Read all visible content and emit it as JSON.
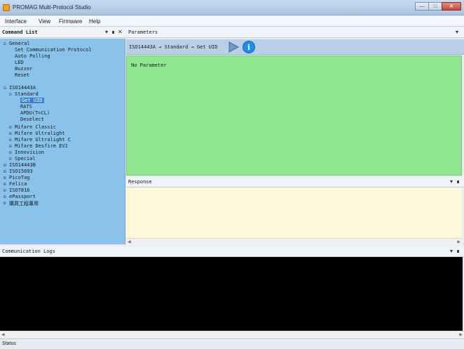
{
  "window": {
    "title": "PROMAG Multi-Protocol Studio"
  },
  "menu": {
    "items": [
      "Interface",
      "View",
      "Firmware",
      "Help"
    ]
  },
  "command_list": {
    "header": "Command List",
    "tree": [
      "General",
      "Set Communication Protocol",
      "Auto Polling",
      "LED",
      "Buzzer",
      "Reset",
      "ISO14443A",
      "Standard",
      "Get UID",
      "RATS",
      "APDU(T=CL)",
      "Deselect",
      "Mifare Classic",
      "Mifare Ultralight",
      "Mifare Ultralight C",
      "Mifare Desfire EV1",
      "Innovision",
      "Special",
      "ISO14443B",
      "ISO15693",
      "PicoTag",
      "Felica",
      "ISO7816",
      "ePassport",
      "購買工程專用"
    ],
    "selected": "Get UID"
  },
  "parameters": {
    "header": "Parameters",
    "breadcrumb": "ISO14443A → Standard → Get UID",
    "body_text": "No Parameter"
  },
  "response": {
    "header": "Response"
  },
  "logs": {
    "header": "Communication Logs"
  },
  "status": {
    "text": "Status"
  },
  "colors": {
    "tree_bg": "#89c3ec",
    "param_bg": "#8fe88f",
    "response_bg": "#fff8d8",
    "log_bg": "#000000",
    "selected_bg": "#3b7fd6"
  }
}
